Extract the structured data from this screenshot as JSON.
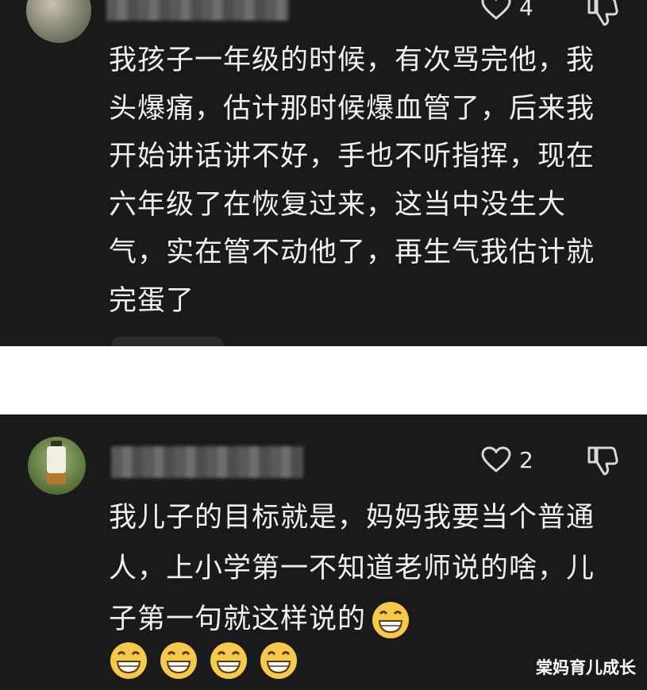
{
  "comment_1": {
    "like_count": "4",
    "text": "我孩子一年级的时候，有次骂完他，我头爆痛，估计那时候爆血管了，后来我开始讲话讲不好，手也不听指挥，现在六年级了在恢复过来，这当中没生大气，实在管不动他了，再生气我估计就完蛋了"
  },
  "comment_2": {
    "like_count": "2",
    "text": "我儿子的目标就是，妈妈我要当个普通人，上小学第一不知道老师说的啥，儿子第一句就这样说的",
    "emoji_inline": "grinning-face-emoji",
    "emoji_row_count": 4
  },
  "watermark": "棠妈育儿成长",
  "colors": {
    "panel_bg": "#1a1a1a",
    "text": "#f0f0f0",
    "page_bg": "#ffffff"
  }
}
